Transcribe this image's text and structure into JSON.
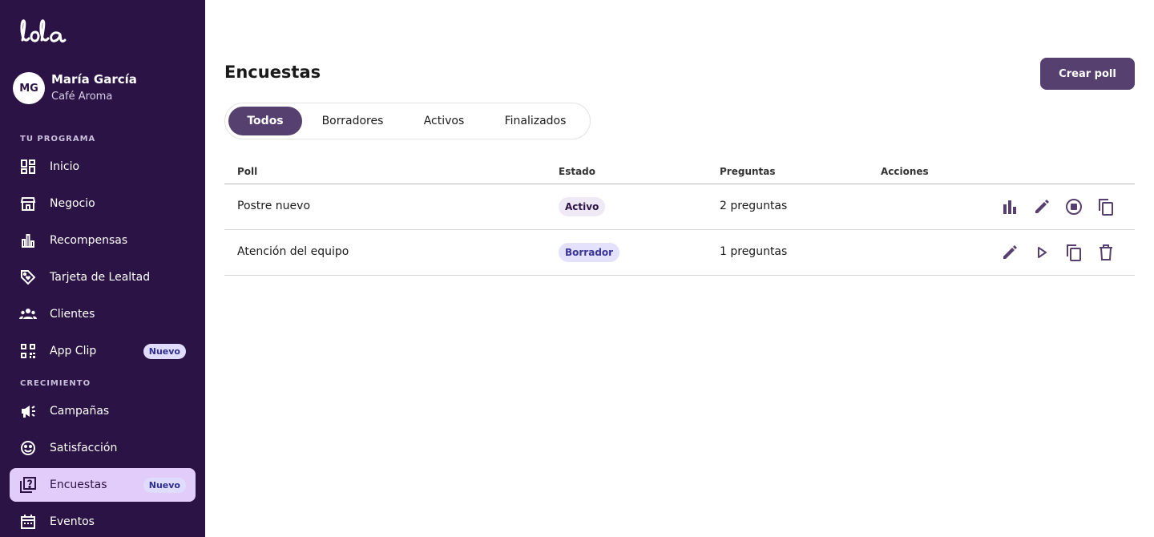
{
  "app": {
    "logo_text": "lola",
    "brand_color": "#2b1445",
    "accent_color": "#56406f"
  },
  "profile": {
    "initials": "MG",
    "name": "María García",
    "business": "Café Aroma"
  },
  "sidebar": {
    "section_program": "TU PROGRAMA",
    "section_growth": "CRECIMIENTO",
    "items": [
      {
        "label": "Inicio",
        "icon": "dashboard-icon"
      },
      {
        "label": "Negocio",
        "icon": "store-icon"
      },
      {
        "label": "Recompensas",
        "icon": "bar-chart-icon"
      },
      {
        "label": "Tarjeta de Lealtad",
        "icon": "tag-heart-icon"
      },
      {
        "label": "Clientes",
        "icon": "people-icon"
      },
      {
        "label": "App Clip",
        "icon": "qr-code-icon",
        "badge": "Nuevo"
      },
      {
        "label": "Campañas",
        "icon": "campaign-icon"
      },
      {
        "label": "Satisfacción",
        "icon": "smiley-icon"
      },
      {
        "label": "Encuestas",
        "icon": "quiz-icon",
        "badge": "Nuevo",
        "active": true
      },
      {
        "label": "Eventos",
        "icon": "calendar-icon"
      }
    ]
  },
  "main": {
    "title": "Encuestas",
    "create_button": "Crear poll",
    "tabs": [
      {
        "label": "Todos",
        "active": true
      },
      {
        "label": "Borradores"
      },
      {
        "label": "Activos"
      },
      {
        "label": "Finalizados"
      }
    ],
    "table": {
      "headers": [
        "Poll",
        "Estado",
        "Preguntas",
        "Acciones"
      ],
      "rows": [
        {
          "poll": "Postre nuevo",
          "status": "Activo",
          "questions": "2 preguntas",
          "actions": [
            "results-icon",
            "edit-icon",
            "stop-icon",
            "copy-icon"
          ]
        },
        {
          "poll": "Atención del equipo",
          "status": "Borrador",
          "questions": "1 preguntas",
          "actions": [
            "edit-icon",
            "play-icon",
            "copy-icon",
            "delete-icon"
          ]
        }
      ]
    }
  }
}
